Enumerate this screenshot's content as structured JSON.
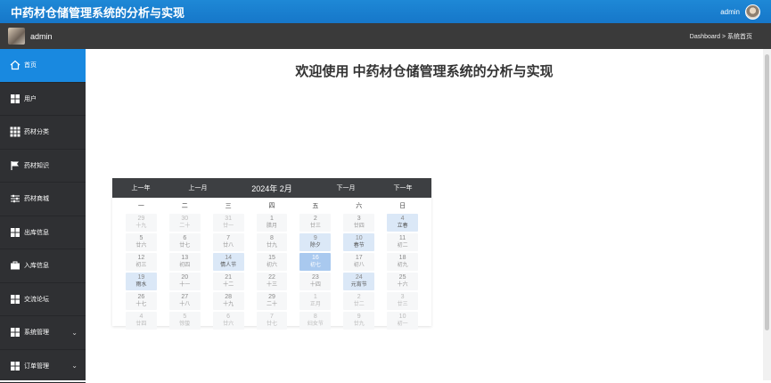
{
  "header": {
    "title": "中药材仓储管理系统的分析与实现",
    "user": "admin"
  },
  "subheader": {
    "user": "admin",
    "breadcrumb": "Dashboard > 系统首页"
  },
  "sidebar": {
    "items": [
      {
        "label": "首页",
        "icon": "home-icon",
        "active": true
      },
      {
        "label": "用户",
        "icon": "grid-icon"
      },
      {
        "label": "药材分类",
        "icon": "grid9-icon"
      },
      {
        "label": "药材知识",
        "icon": "flag-icon"
      },
      {
        "label": "药材商城",
        "icon": "sliders-icon"
      },
      {
        "label": "出库信息",
        "icon": "grid-icon"
      },
      {
        "label": "入库信息",
        "icon": "briefcase-icon"
      },
      {
        "label": "交流论坛",
        "icon": "grid-icon"
      },
      {
        "label": "系统管理",
        "icon": "grid-icon",
        "expandable": true
      },
      {
        "label": "订单管理",
        "icon": "grid-icon",
        "expandable": true
      }
    ]
  },
  "main": {
    "welcome": "欢迎使用 中药材仓储管理系统的分析与实现"
  },
  "calendar": {
    "prev_year": "上一年",
    "prev_month": "上一月",
    "current": "2024年 2月",
    "next_month": "下一月",
    "next_year": "下一年",
    "weekdays": [
      "一",
      "二",
      "三",
      "四",
      "五",
      "六",
      "日"
    ],
    "days": [
      {
        "d": "29",
        "l": "十九",
        "other": true
      },
      {
        "d": "30",
        "l": "二十",
        "other": true
      },
      {
        "d": "31",
        "l": "廿一",
        "other": true
      },
      {
        "d": "1",
        "l": "腊月"
      },
      {
        "d": "2",
        "l": "廿三"
      },
      {
        "d": "3",
        "l": "廿四"
      },
      {
        "d": "4",
        "l": "立春",
        "hol": true
      },
      {
        "d": "5",
        "l": "廿六"
      },
      {
        "d": "6",
        "l": "廿七"
      },
      {
        "d": "7",
        "l": "廿八"
      },
      {
        "d": "8",
        "l": "廿九"
      },
      {
        "d": "9",
        "l": "除夕",
        "hol": true
      },
      {
        "d": "10",
        "l": "春节",
        "hol": true
      },
      {
        "d": "11",
        "l": "初二"
      },
      {
        "d": "12",
        "l": "初三"
      },
      {
        "d": "13",
        "l": "初四"
      },
      {
        "d": "14",
        "l": "情人节",
        "hol": true
      },
      {
        "d": "15",
        "l": "初六"
      },
      {
        "d": "16",
        "l": "初七",
        "today": true
      },
      {
        "d": "17",
        "l": "初八"
      },
      {
        "d": "18",
        "l": "初九"
      },
      {
        "d": "19",
        "l": "雨水",
        "hol": true
      },
      {
        "d": "20",
        "l": "十一"
      },
      {
        "d": "21",
        "l": "十二"
      },
      {
        "d": "22",
        "l": "十三"
      },
      {
        "d": "23",
        "l": "十四"
      },
      {
        "d": "24",
        "l": "元宵节",
        "hol": true
      },
      {
        "d": "25",
        "l": "十六"
      },
      {
        "d": "26",
        "l": "十七"
      },
      {
        "d": "27",
        "l": "十八"
      },
      {
        "d": "28",
        "l": "十九"
      },
      {
        "d": "29",
        "l": "二十"
      },
      {
        "d": "1",
        "l": "正月",
        "other": true
      },
      {
        "d": "2",
        "l": "廿二",
        "other": true
      },
      {
        "d": "3",
        "l": "廿三",
        "other": true
      },
      {
        "d": "4",
        "l": "廿四",
        "other": true
      },
      {
        "d": "5",
        "l": "惊蛰",
        "other": true
      },
      {
        "d": "6",
        "l": "廿六",
        "other": true
      },
      {
        "d": "7",
        "l": "廿七",
        "other": true
      },
      {
        "d": "8",
        "l": "妇女节",
        "other": true
      },
      {
        "d": "9",
        "l": "廿九",
        "other": true
      },
      {
        "d": "10",
        "l": "初一",
        "other": true
      }
    ]
  },
  "colors": {
    "topbar": "#1677c9",
    "subbar": "#3a3a3a",
    "sidebar": "#2f3033",
    "active": "#1989e0"
  }
}
